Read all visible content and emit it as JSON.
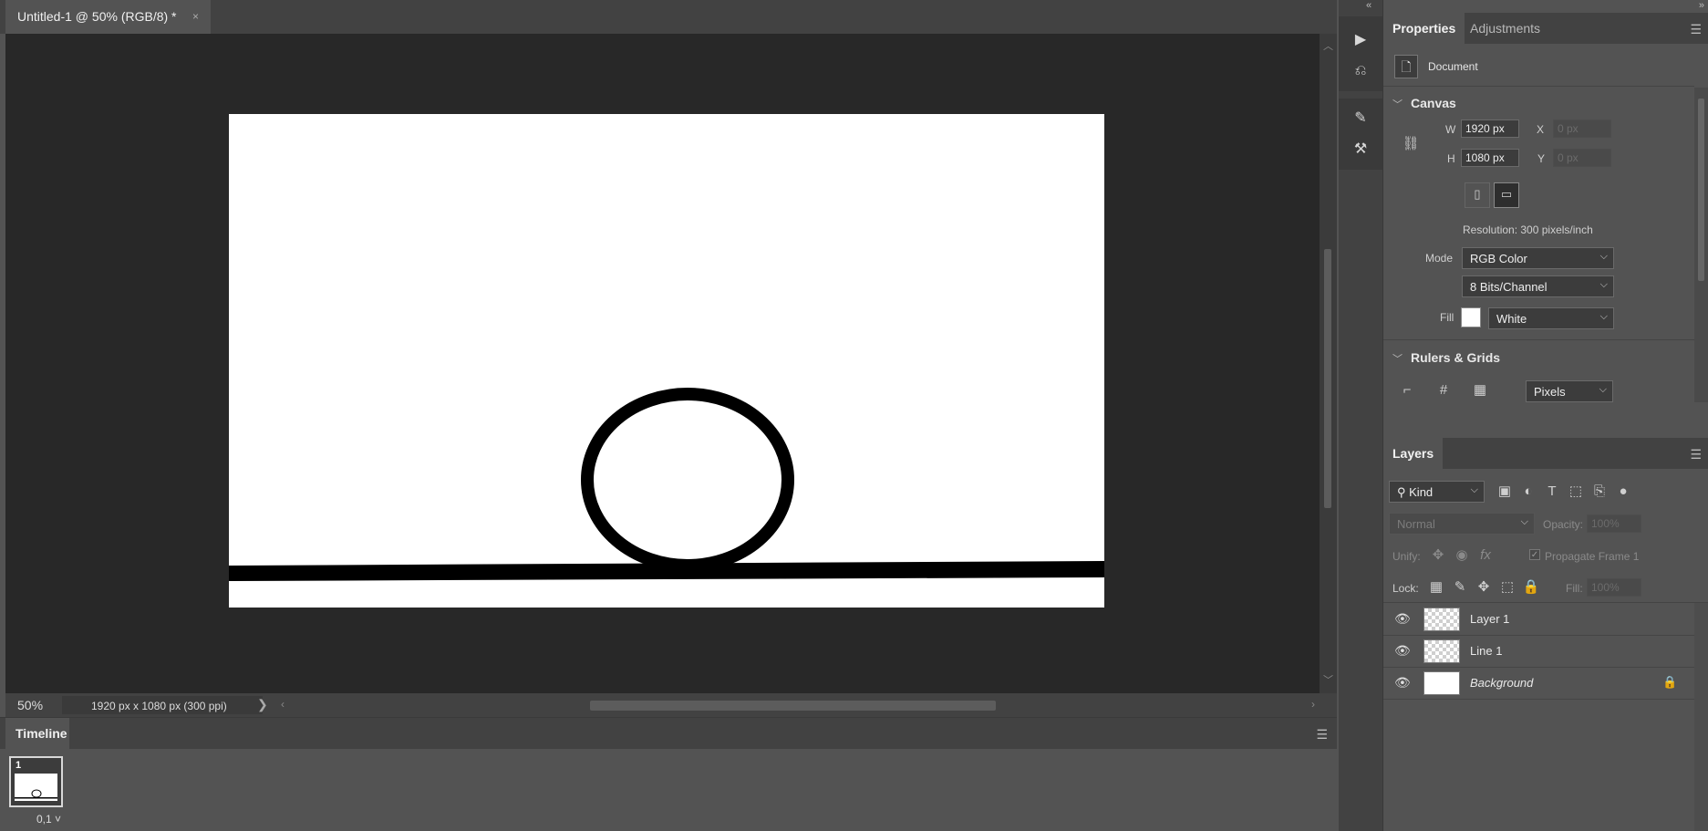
{
  "document": {
    "tab_title": "Untitled-1 @ 50% (RGB/8) *",
    "close_glyph": "×"
  },
  "status": {
    "zoom": "50%",
    "doc_info": "1920 px x 1080 px (300 ppi)",
    "arrow": "❯"
  },
  "timeline": {
    "tab_label": "Timeline",
    "frame_number": "1",
    "frame_delay": "0,1 ˅"
  },
  "properties": {
    "tab_properties": "Properties",
    "tab_adjustments": "Adjustments",
    "document_label": "Document",
    "canvas_header": "Canvas",
    "w_label": "W",
    "w_value": "1920 px",
    "h_label": "H",
    "h_value": "1080 px",
    "x_label": "X",
    "x_value": "0 px",
    "y_label": "Y",
    "y_value": "0 px",
    "resolution": "Resolution: 300 pixels/inch",
    "mode_label": "Mode",
    "mode_value": "RGB Color",
    "bits_value": "8 Bits/Channel",
    "fill_label": "Fill",
    "fill_value": "White",
    "rulers_header": "Rulers & Grids",
    "units_value": "Pixels"
  },
  "layers": {
    "tab_label": "Layers",
    "kind_value": "Kind",
    "blend_mode": "Normal",
    "opacity_label": "Opacity:",
    "opacity_value": "100%",
    "unify_label": "Unify:",
    "propagate_label": "Propagate Frame 1",
    "lock_label": "Lock:",
    "fill_label": "Fill:",
    "fill_value": "100%",
    "items": [
      {
        "name": "Layer 1"
      },
      {
        "name": "Line 1"
      },
      {
        "name": "Background"
      }
    ]
  },
  "icons": {
    "play": "play-icon",
    "history": "history-icon",
    "brush_settings": "brush-settings-icon",
    "brush_presets": "brush-presets-icon",
    "panel_menu": "panel-menu-icon",
    "eye": "eye-icon",
    "lock": "lock-icon"
  },
  "colors": {
    "accent": "#ffffff",
    "canvas_bg": "#ffffff",
    "workspace": "#282828",
    "panel": "#535353"
  }
}
